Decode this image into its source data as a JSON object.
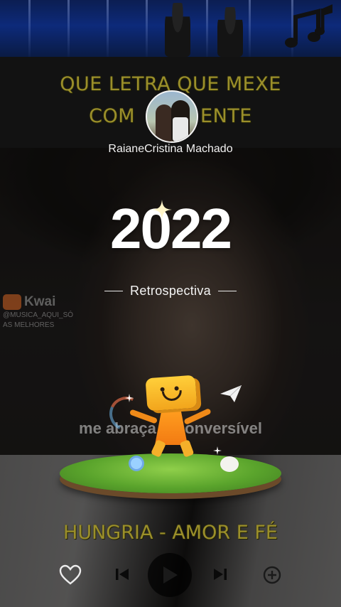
{
  "lyrics": {
    "line1": "QUE LETRA QUE MEXE",
    "line2_left": "COM",
    "line2_right": "ENTE",
    "middle_overlay_left": "me abraça",
    "middle_overlay_right": "conversível"
  },
  "profile": {
    "display_name": "RaianeCristina Machado"
  },
  "recap": {
    "year": "2022",
    "label": "Retrospectiva"
  },
  "watermark": {
    "brand": "Kwai",
    "handle_line1": "@MUSICA_AQUI_SÓ",
    "handle_line2": "AS MELHORES"
  },
  "song": {
    "title": "HUNGRIA - AMOR E FÉ"
  },
  "player": {
    "icons": [
      "heart-icon",
      "previous-icon",
      "play-icon",
      "next-icon",
      "more-icon"
    ]
  },
  "colors": {
    "lyric_yellow": "#9b8f2a",
    "text_white": "#ffffff"
  }
}
